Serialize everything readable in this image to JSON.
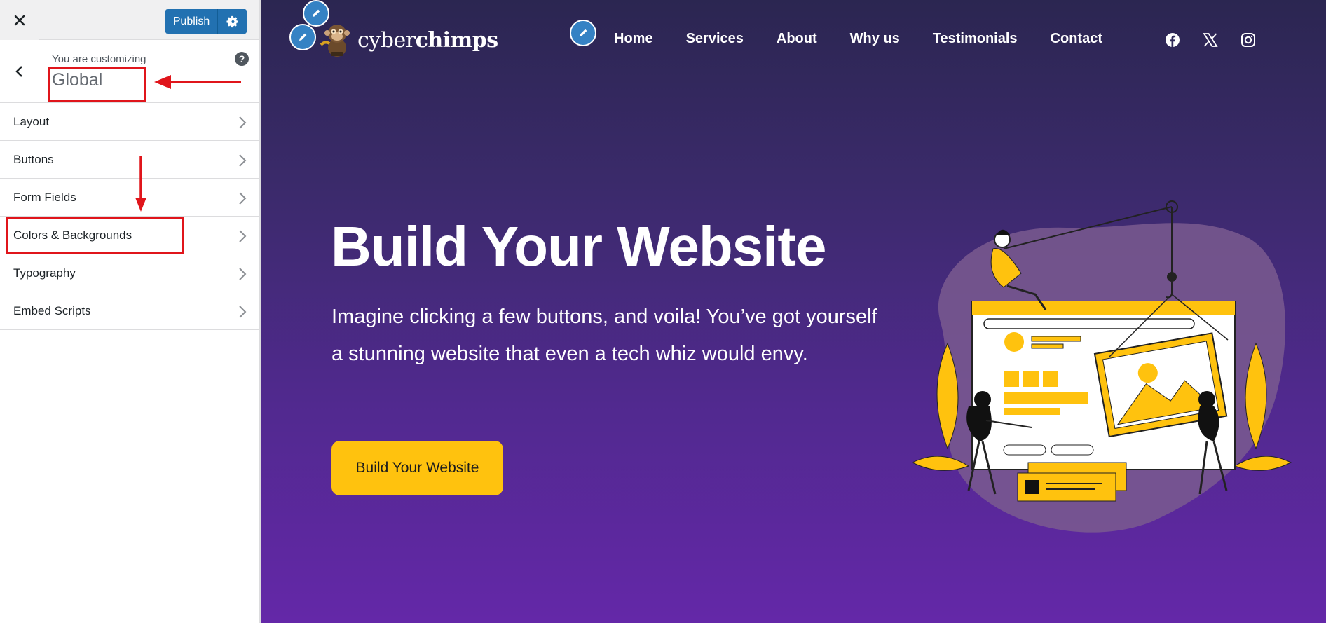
{
  "sidebar": {
    "publish_label": "Publish",
    "customizing_label": "You are customizing",
    "section_title": "Global",
    "items": [
      {
        "label": "Layout"
      },
      {
        "label": "Buttons"
      },
      {
        "label": "Form Fields"
      },
      {
        "label": "Colors & Backgrounds"
      },
      {
        "label": "Typography"
      },
      {
        "label": "Embed Scripts"
      }
    ]
  },
  "site": {
    "logo_text_light": "cyber",
    "logo_text_bold": "chimps",
    "nav": [
      "Home",
      "Services",
      "About",
      "Why us",
      "Testimonials",
      "Contact"
    ],
    "social_icons": [
      "facebook-icon",
      "x-twitter-icon",
      "instagram-icon"
    ],
    "hero": {
      "title": "Build Your Website",
      "description": "Imagine clicking a few buttons, and voila! You’ve got yourself a stunning website that even a tech whiz would envy.",
      "button_label": "Build Your Website"
    }
  },
  "colors": {
    "publish_blue": "#2271b1",
    "annotation_red": "#e0151b",
    "hero_yellow": "#ffc20e",
    "bg_top": "#2b2651",
    "bg_bottom": "#6428a8"
  }
}
